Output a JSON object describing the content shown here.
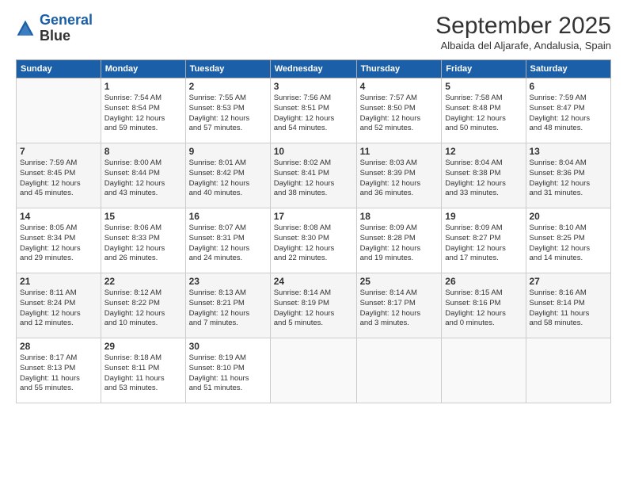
{
  "header": {
    "logo_line1": "General",
    "logo_line2": "Blue",
    "month": "September 2025",
    "location": "Albaida del Aljarafe, Andalusia, Spain"
  },
  "weekdays": [
    "Sunday",
    "Monday",
    "Tuesday",
    "Wednesday",
    "Thursday",
    "Friday",
    "Saturday"
  ],
  "weeks": [
    [
      {
        "day": "",
        "info": ""
      },
      {
        "day": "1",
        "info": "Sunrise: 7:54 AM\nSunset: 8:54 PM\nDaylight: 12 hours\nand 59 minutes."
      },
      {
        "day": "2",
        "info": "Sunrise: 7:55 AM\nSunset: 8:53 PM\nDaylight: 12 hours\nand 57 minutes."
      },
      {
        "day": "3",
        "info": "Sunrise: 7:56 AM\nSunset: 8:51 PM\nDaylight: 12 hours\nand 54 minutes."
      },
      {
        "day": "4",
        "info": "Sunrise: 7:57 AM\nSunset: 8:50 PM\nDaylight: 12 hours\nand 52 minutes."
      },
      {
        "day": "5",
        "info": "Sunrise: 7:58 AM\nSunset: 8:48 PM\nDaylight: 12 hours\nand 50 minutes."
      },
      {
        "day": "6",
        "info": "Sunrise: 7:59 AM\nSunset: 8:47 PM\nDaylight: 12 hours\nand 48 minutes."
      }
    ],
    [
      {
        "day": "7",
        "info": "Sunrise: 7:59 AM\nSunset: 8:45 PM\nDaylight: 12 hours\nand 45 minutes."
      },
      {
        "day": "8",
        "info": "Sunrise: 8:00 AM\nSunset: 8:44 PM\nDaylight: 12 hours\nand 43 minutes."
      },
      {
        "day": "9",
        "info": "Sunrise: 8:01 AM\nSunset: 8:42 PM\nDaylight: 12 hours\nand 40 minutes."
      },
      {
        "day": "10",
        "info": "Sunrise: 8:02 AM\nSunset: 8:41 PM\nDaylight: 12 hours\nand 38 minutes."
      },
      {
        "day": "11",
        "info": "Sunrise: 8:03 AM\nSunset: 8:39 PM\nDaylight: 12 hours\nand 36 minutes."
      },
      {
        "day": "12",
        "info": "Sunrise: 8:04 AM\nSunset: 8:38 PM\nDaylight: 12 hours\nand 33 minutes."
      },
      {
        "day": "13",
        "info": "Sunrise: 8:04 AM\nSunset: 8:36 PM\nDaylight: 12 hours\nand 31 minutes."
      }
    ],
    [
      {
        "day": "14",
        "info": "Sunrise: 8:05 AM\nSunset: 8:34 PM\nDaylight: 12 hours\nand 29 minutes."
      },
      {
        "day": "15",
        "info": "Sunrise: 8:06 AM\nSunset: 8:33 PM\nDaylight: 12 hours\nand 26 minutes."
      },
      {
        "day": "16",
        "info": "Sunrise: 8:07 AM\nSunset: 8:31 PM\nDaylight: 12 hours\nand 24 minutes."
      },
      {
        "day": "17",
        "info": "Sunrise: 8:08 AM\nSunset: 8:30 PM\nDaylight: 12 hours\nand 22 minutes."
      },
      {
        "day": "18",
        "info": "Sunrise: 8:09 AM\nSunset: 8:28 PM\nDaylight: 12 hours\nand 19 minutes."
      },
      {
        "day": "19",
        "info": "Sunrise: 8:09 AM\nSunset: 8:27 PM\nDaylight: 12 hours\nand 17 minutes."
      },
      {
        "day": "20",
        "info": "Sunrise: 8:10 AM\nSunset: 8:25 PM\nDaylight: 12 hours\nand 14 minutes."
      }
    ],
    [
      {
        "day": "21",
        "info": "Sunrise: 8:11 AM\nSunset: 8:24 PM\nDaylight: 12 hours\nand 12 minutes."
      },
      {
        "day": "22",
        "info": "Sunrise: 8:12 AM\nSunset: 8:22 PM\nDaylight: 12 hours\nand 10 minutes."
      },
      {
        "day": "23",
        "info": "Sunrise: 8:13 AM\nSunset: 8:21 PM\nDaylight: 12 hours\nand 7 minutes."
      },
      {
        "day": "24",
        "info": "Sunrise: 8:14 AM\nSunset: 8:19 PM\nDaylight: 12 hours\nand 5 minutes."
      },
      {
        "day": "25",
        "info": "Sunrise: 8:14 AM\nSunset: 8:17 PM\nDaylight: 12 hours\nand 3 minutes."
      },
      {
        "day": "26",
        "info": "Sunrise: 8:15 AM\nSunset: 8:16 PM\nDaylight: 12 hours\nand 0 minutes."
      },
      {
        "day": "27",
        "info": "Sunrise: 8:16 AM\nSunset: 8:14 PM\nDaylight: 11 hours\nand 58 minutes."
      }
    ],
    [
      {
        "day": "28",
        "info": "Sunrise: 8:17 AM\nSunset: 8:13 PM\nDaylight: 11 hours\nand 55 minutes."
      },
      {
        "day": "29",
        "info": "Sunrise: 8:18 AM\nSunset: 8:11 PM\nDaylight: 11 hours\nand 53 minutes."
      },
      {
        "day": "30",
        "info": "Sunrise: 8:19 AM\nSunset: 8:10 PM\nDaylight: 11 hours\nand 51 minutes."
      },
      {
        "day": "",
        "info": ""
      },
      {
        "day": "",
        "info": ""
      },
      {
        "day": "",
        "info": ""
      },
      {
        "day": "",
        "info": ""
      }
    ]
  ]
}
